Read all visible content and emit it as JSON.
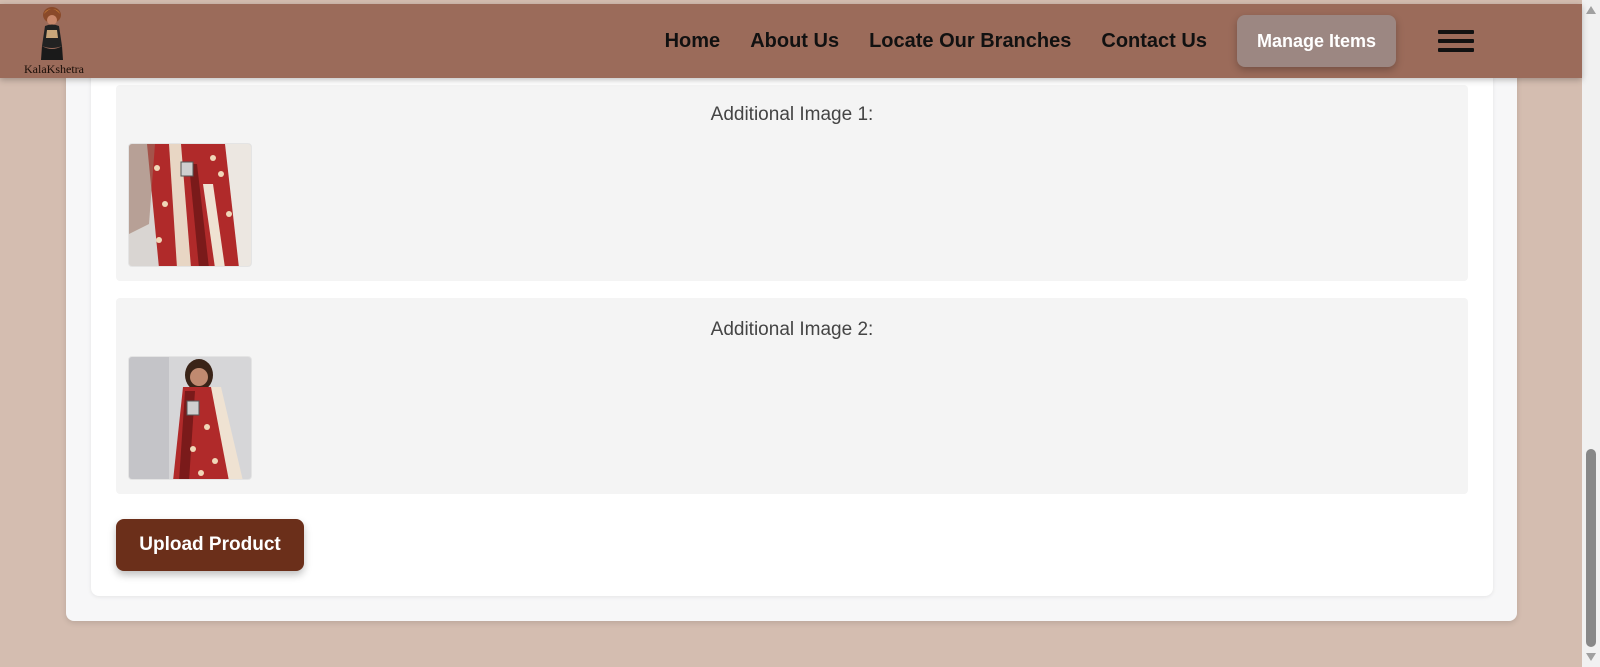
{
  "brand": {
    "name": "KalaKshetra",
    "logo_icon": "woman-figure-logo"
  },
  "nav": {
    "links": [
      "Home",
      "About Us",
      "Locate Our Branches",
      "Contact Us"
    ],
    "manage_label": "Manage Items",
    "menu_icon": "hamburger-menu-icon"
  },
  "form": {
    "sections": [
      {
        "label": "Additional Image 1:",
        "image": "saree-photo-1"
      },
      {
        "label": "Additional Image 2:",
        "image": "saree-photo-2"
      }
    ],
    "upload_label": "Upload Product"
  },
  "colors": {
    "header": "#9b6b5a",
    "page_bg": "#d4bdb0",
    "manage_button": "#9c8782",
    "upload_button": "#6b2f1a",
    "saree_red": "#b02a2a"
  }
}
